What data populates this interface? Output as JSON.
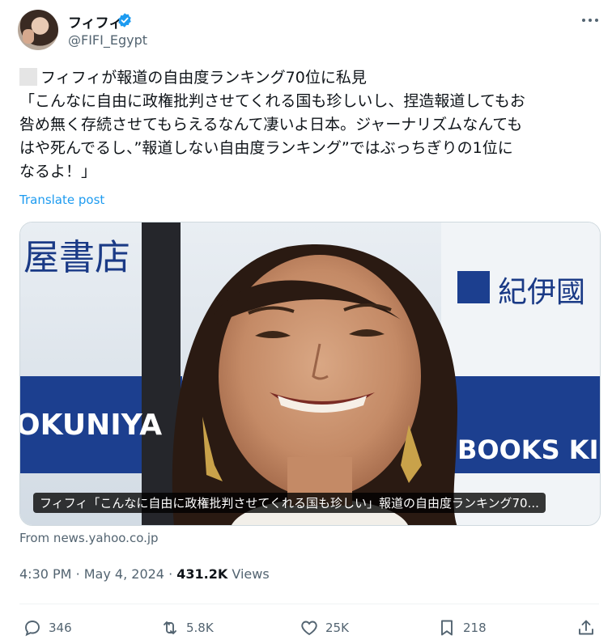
{
  "author": {
    "display_name": "フィフィ",
    "handle": "@FIFI_Egypt"
  },
  "post": {
    "lines": [
      "フィフィが報道の自由度ランキング70位に私見",
      "「こんなに自由に政権批判させてくれる国も珍しいし、捏造報道してもお",
      "咎め無く存続させてもらえるなんて凄いよ日本。ジャーナリズムなんても",
      "はや死んでるし、”報道しない自由度ランキング”ではぶっちぎりの1位に",
      "なるよ！」"
    ],
    "translate_label": "Translate post"
  },
  "media": {
    "caption": "フィフィ「こんなに自由に政権批判させてくれる国も珍しい」報道の自由度ランキング70...",
    "backdrop_texts": [
      "屋書店",
      "OKUNIYA",
      "紀伊國",
      "BOOKS KINO"
    ],
    "source": "From news.yahoo.co.jp"
  },
  "meta": {
    "time": "4:30 PM",
    "date": "May 4, 2024",
    "separator": "·",
    "views_count": "431.2K",
    "views_label": "Views"
  },
  "actions": {
    "replies": "346",
    "reposts": "5.8K",
    "likes": "25K",
    "bookmarks": "218"
  },
  "icons": [
    "verified-badge-icon",
    "more-icon",
    "reply-icon",
    "repost-icon",
    "like-icon",
    "bookmark-icon",
    "share-icon"
  ],
  "colors": {
    "link": "#1d9bf0",
    "secondary_text": "#536471",
    "primary_text": "#0f1419",
    "verified": "#1d9bf0"
  }
}
